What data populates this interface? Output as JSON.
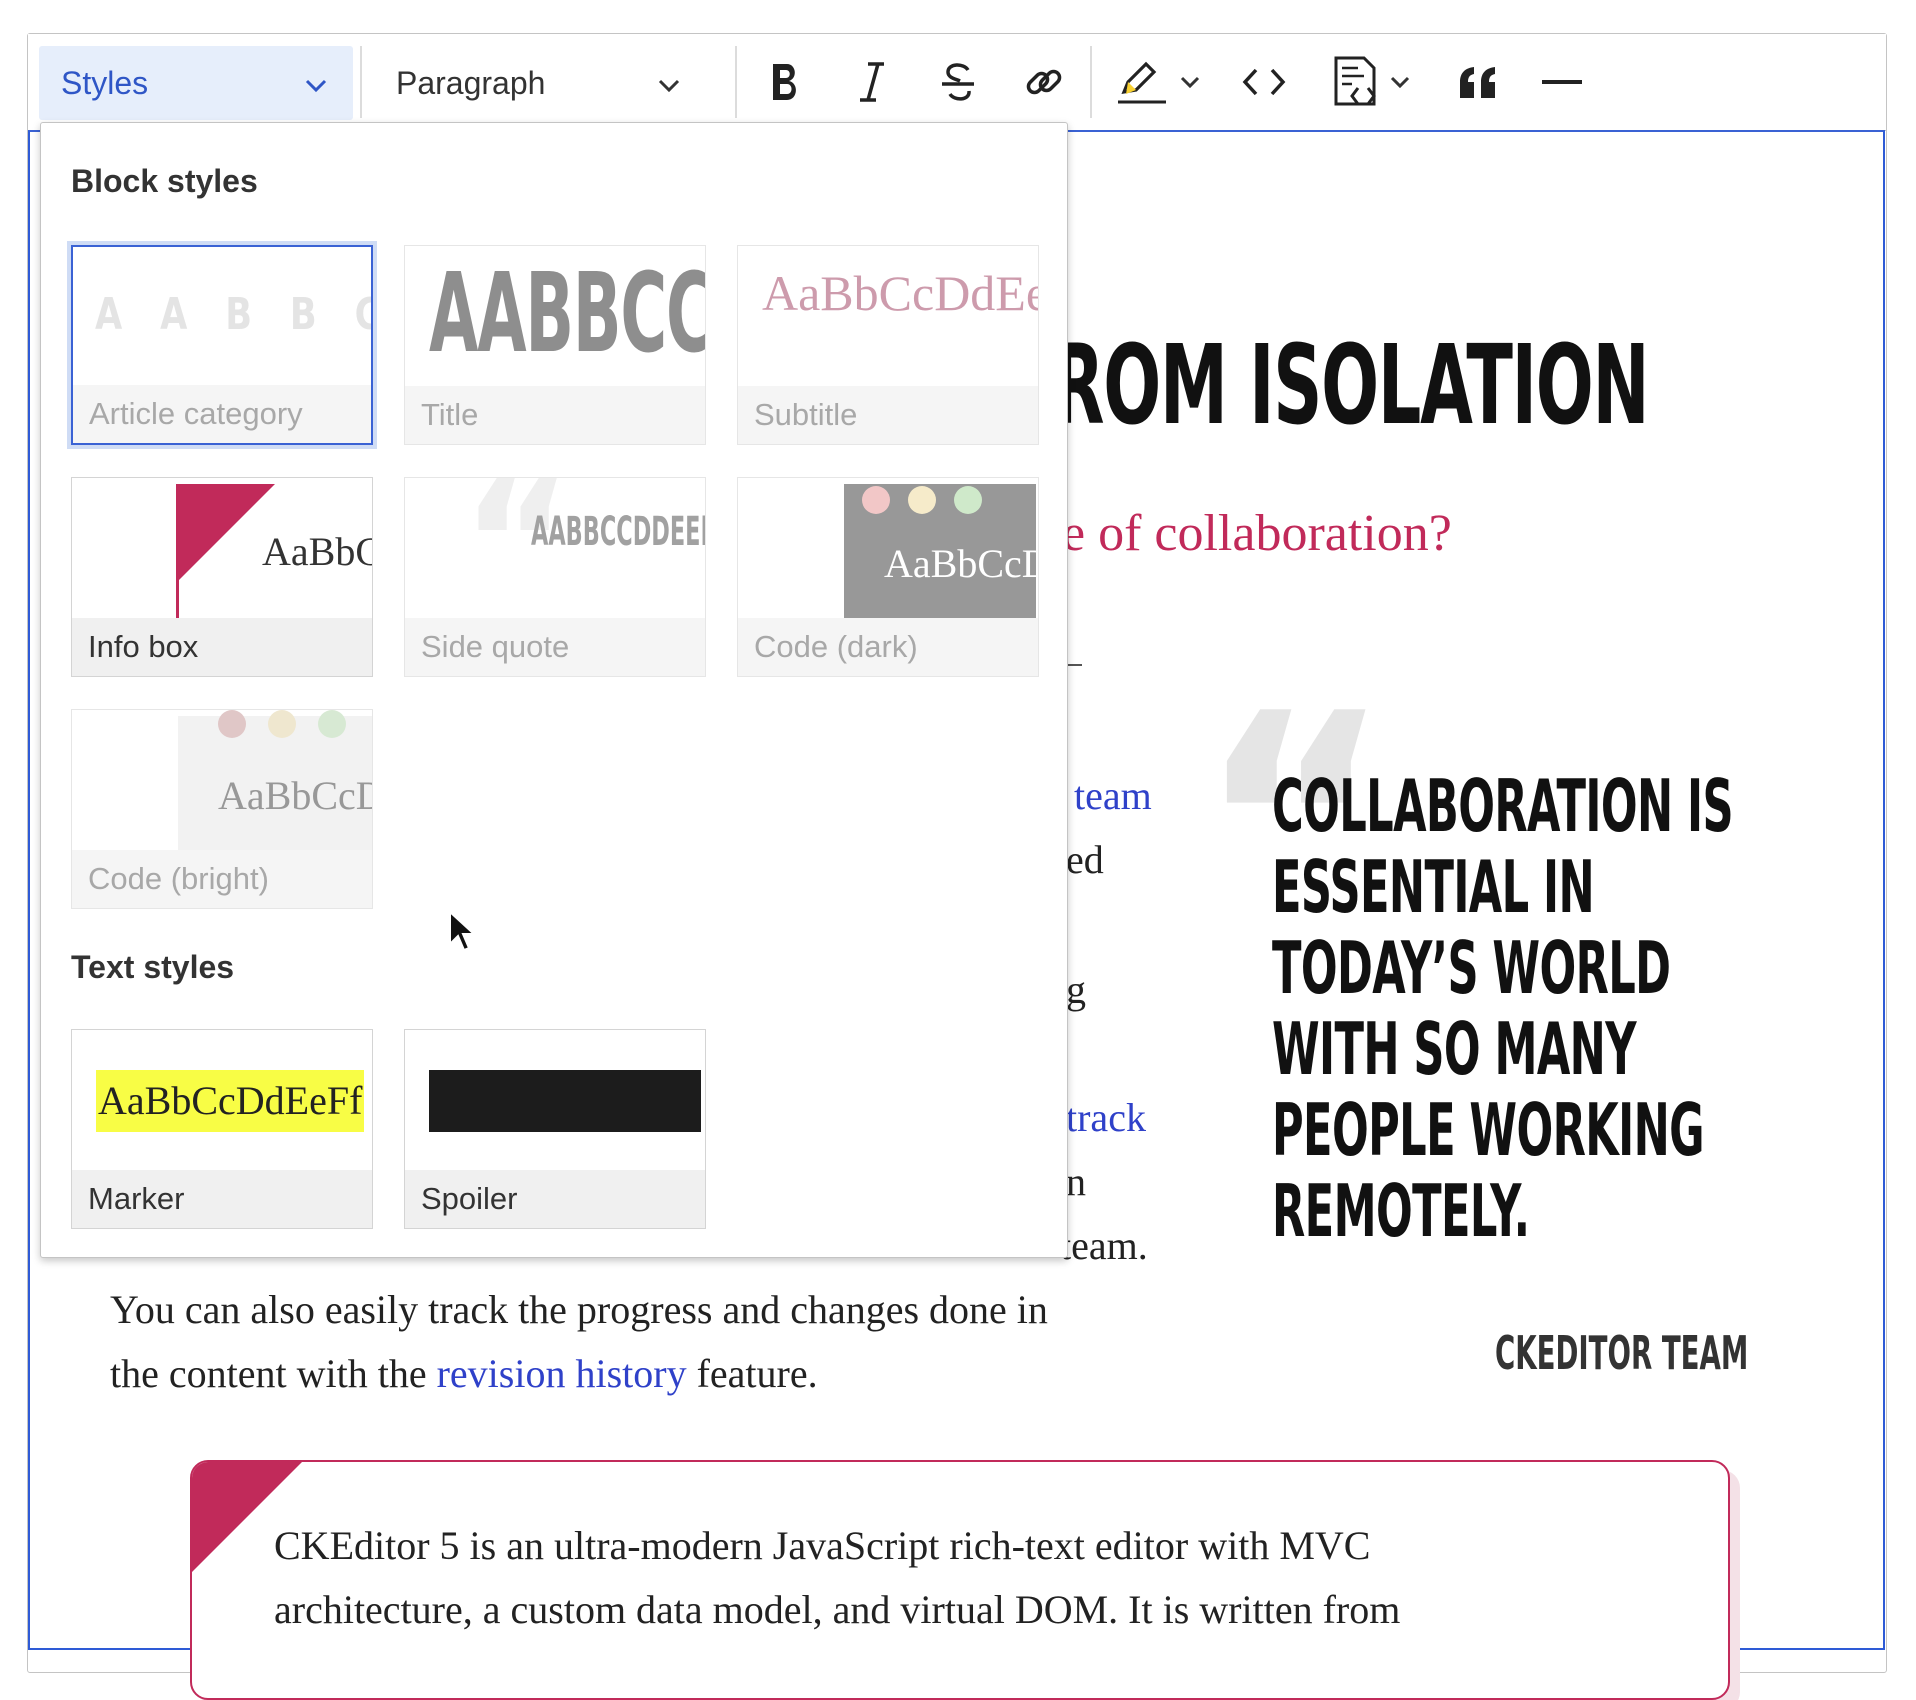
{
  "toolbar": {
    "styles_label": "Styles",
    "heading_label": "Paragraph",
    "icons": [
      "bold-icon",
      "italic-icon",
      "strikethrough-icon",
      "link-icon",
      "highlight-icon",
      "code-icon",
      "code-block-icon",
      "blockquote-icon",
      "horizontal-line-icon"
    ]
  },
  "article": {
    "title_fragment": "ROM ISOLATION",
    "subtitle_fragment": "e of collaboration?",
    "body": {
      "frag_team": "team",
      "frag_ed": "ed",
      "frag_g": "g",
      "frag_track": "track",
      "frag_n": "n",
      "frag_team2": "team.",
      "line_progress": "You can also easily track the progress and changes done in",
      "line_content_prefix": "the content with the",
      "link_revision": "revision history",
      "line_content_suffix": "feature."
    },
    "side_quote": {
      "lines": [
        "COLLABORATION IS",
        "ESSENTIAL IN",
        "TODAY’S WORLD",
        "WITH SO MANY",
        "PEOPLE WORKING",
        "REMOTELY."
      ],
      "author": "CKEDITOR TEAM"
    },
    "info_box": {
      "line1": "CKEditor 5 is an ultra-modern JavaScript rich-text editor with MVC",
      "line2": "architecture, a custom data model, and virtual DOM. It is written from"
    }
  },
  "styles_panel": {
    "block_title": "Block styles",
    "text_title": "Text styles",
    "block_styles": [
      {
        "label": "Article category",
        "preview": "A A B B C C"
      },
      {
        "label": "Title",
        "preview": "AABBCC"
      },
      {
        "label": "Subtitle",
        "preview": "AaBbCcDdEe"
      },
      {
        "label": "Info box",
        "preview": "AaBbC"
      },
      {
        "label": "Side quote",
        "preview": "AABBCCDDEEF"
      },
      {
        "label": "Code (dark)",
        "preview": "AaBbCcD"
      },
      {
        "label": "Code (bright)",
        "preview": "AaBbCcD"
      }
    ],
    "text_styles": [
      {
        "label": "Marker",
        "preview": "AaBbCcDdEeFf"
      },
      {
        "label": "Spoiler",
        "preview": ""
      }
    ]
  },
  "colors": {
    "accent": "#2f56c6",
    "focus": "#3a62d4",
    "brand_pink": "#c12a5a",
    "marker_yellow": "#f8fd45"
  }
}
